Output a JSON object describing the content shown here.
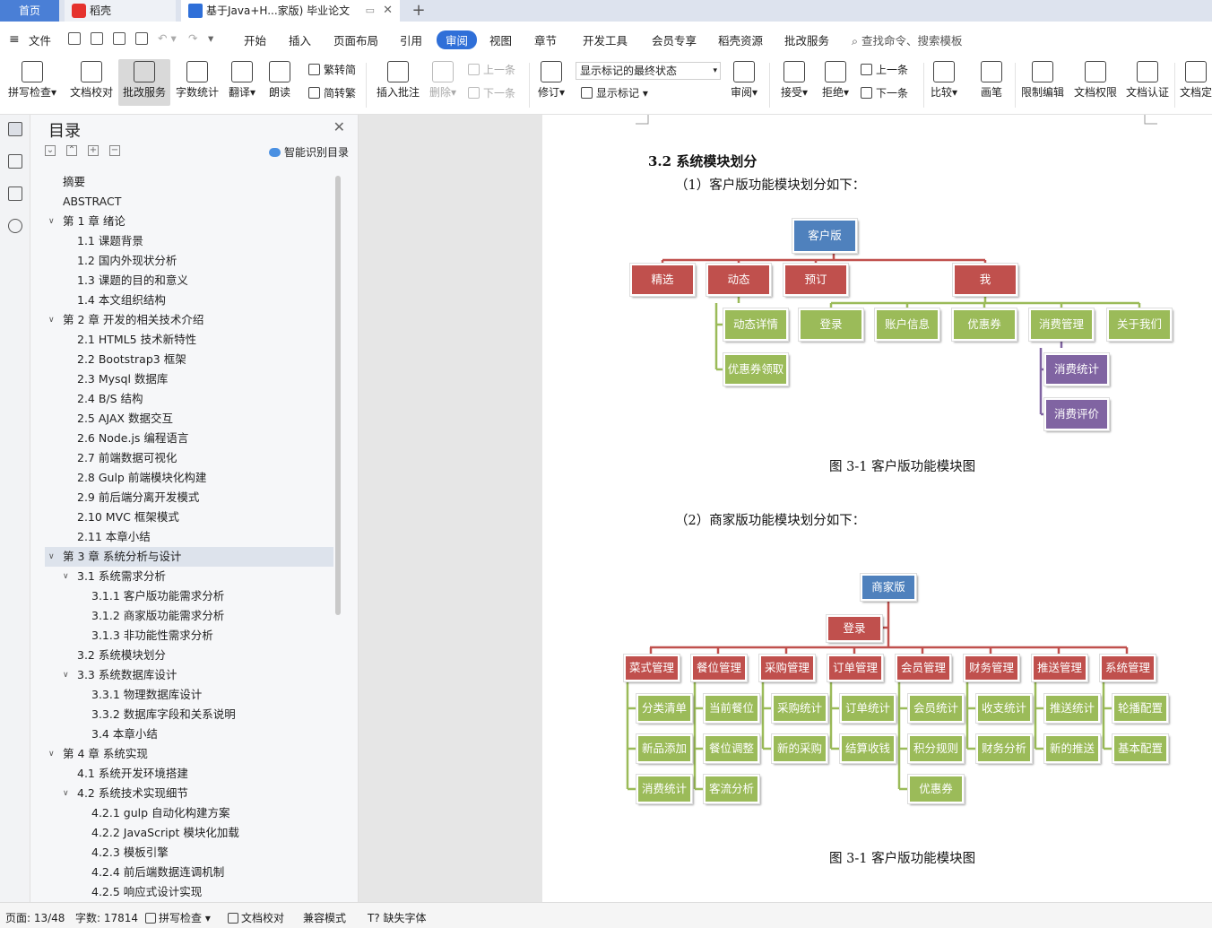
{
  "tabs": {
    "home": "首页",
    "daoke": "稻壳",
    "doc": "基于Java+H...家版)  毕业论文"
  },
  "menu": [
    "文件",
    "开始",
    "插入",
    "页面布局",
    "引用",
    "审阅",
    "视图",
    "章节",
    "开发工具",
    "会员专享",
    "稻壳资源",
    "批改服务"
  ],
  "search_placeholder": "查找命令、搜索模板",
  "ribbon": {
    "big": [
      "拼写检查",
      "文档校对",
      "批改服务",
      "字数统计",
      "翻译",
      "朗读",
      "插入批注",
      "删除",
      "修订",
      "审阅",
      "接受",
      "拒绝",
      "比较",
      "画笔",
      "限制编辑",
      "文档权限",
      "文档认证",
      "文档定"
    ],
    "small": {
      "trad": "繁转简",
      "simp": "简转繁",
      "prev1": "上一条",
      "next1": "下一条",
      "show_markup": "显示标记",
      "prev2": "上一条",
      "next2": "下一条"
    },
    "markup_state": "显示标记的最终状态"
  },
  "toc": {
    "title": "目录",
    "smart": "智能识别目录",
    "items": [
      {
        "text": "摘要",
        "level": 0,
        "caret": ""
      },
      {
        "text": "ABSTRACT",
        "level": 0,
        "caret": ""
      },
      {
        "text": "第 1 章  绪论",
        "level": 0,
        "caret": "v"
      },
      {
        "text": "1.1  课题背景",
        "level": 1,
        "caret": ""
      },
      {
        "text": "1.2  国内外现状分析",
        "level": 1,
        "caret": ""
      },
      {
        "text": "1.3  课题的目的和意义",
        "level": 1,
        "caret": ""
      },
      {
        "text": "1.4  本文组织结构",
        "level": 1,
        "caret": ""
      },
      {
        "text": "第 2 章  开发的相关技术介绍",
        "level": 0,
        "caret": "v"
      },
      {
        "text": "2.1 HTML5 技术新特性",
        "level": 1,
        "caret": ""
      },
      {
        "text": "2.2 Bootstrap3 框架",
        "level": 1,
        "caret": ""
      },
      {
        "text": "2.3 Mysql 数据库",
        "level": 1,
        "caret": ""
      },
      {
        "text": "2.4 B/S 结构",
        "level": 1,
        "caret": ""
      },
      {
        "text": "2.5 AJAX 数据交互",
        "level": 1,
        "caret": ""
      },
      {
        "text": "2.6 Node.js 编程语言",
        "level": 1,
        "caret": ""
      },
      {
        "text": "2.7 前端数据可视化",
        "level": 1,
        "caret": ""
      },
      {
        "text": "2.8 Gulp 前端模块化构建",
        "level": 1,
        "caret": ""
      },
      {
        "text": "2.9 前后端分离开发模式",
        "level": 1,
        "caret": ""
      },
      {
        "text": "2.10 MVC 框架模式",
        "level": 1,
        "caret": ""
      },
      {
        "text": "2.11  本章小结",
        "level": 1,
        "caret": ""
      },
      {
        "text": "第 3 章  系统分析与设计",
        "level": 0,
        "caret": "v",
        "selected": true
      },
      {
        "text": "3.1  系统需求分析",
        "level": 1,
        "caret": "v"
      },
      {
        "text": "3.1.1  客户版功能需求分析",
        "level": 2,
        "caret": ""
      },
      {
        "text": "3.1.2  商家版功能需求分析",
        "level": 2,
        "caret": ""
      },
      {
        "text": "3.1.3  非功能性需求分析",
        "level": 2,
        "caret": ""
      },
      {
        "text": "3.2  系统模块划分",
        "level": 1,
        "caret": ""
      },
      {
        "text": "3.3  系统数据库设计",
        "level": 1,
        "caret": "v"
      },
      {
        "text": "3.3.1 物理数据库设计",
        "level": 2,
        "caret": ""
      },
      {
        "text": "3.3.2  数据库字段和关系说明",
        "level": 2,
        "caret": ""
      },
      {
        "text": "3.4  本章小结",
        "level": 2,
        "caret": ""
      },
      {
        "text": "第 4 章  系统实现",
        "level": 0,
        "caret": "v"
      },
      {
        "text": "4.1  系统开发环境搭建",
        "level": 1,
        "caret": ""
      },
      {
        "text": "4.2  系统技术实现细节",
        "level": 1,
        "caret": "v"
      },
      {
        "text": "4.2.1 gulp 自动化构建方案",
        "level": 2,
        "caret": ""
      },
      {
        "text": "4.2.2 JavaScript 模块化加载",
        "level": 2,
        "caret": ""
      },
      {
        "text": "4.2.3  模板引擎",
        "level": 2,
        "caret": ""
      },
      {
        "text": "4.2.4  前后端数据连调机制",
        "level": 2,
        "caret": ""
      },
      {
        "text": "4.2.5  响应式设计实现",
        "level": 2,
        "caret": ""
      }
    ]
  },
  "doc": {
    "section_title": "3.2  系统模块划分",
    "sub1": "（1）客户版功能模块划分如下：",
    "caption1": "图  3-1  客户版功能模块图",
    "sub2": "（2）商家版功能模块划分如下：",
    "caption2": "图  3-1  客户版功能模块图",
    "diagram1": {
      "root": "客户版",
      "level1": [
        "精选",
        "动态",
        "预订",
        "我"
      ],
      "dynamic_children": [
        "动态详情",
        "优惠券领取"
      ],
      "me_children": [
        "登录",
        "账户信息",
        "优惠券",
        "消费管理",
        "关于我们"
      ],
      "consume_children": [
        "消费统计",
        "消费评价"
      ]
    },
    "diagram2": {
      "root": "商家版",
      "login": "登录",
      "groups": [
        {
          "name": "菜式管理",
          "children": [
            "分类清单",
            "新品添加",
            "消费统计"
          ]
        },
        {
          "name": "餐位管理",
          "children": [
            "当前餐位",
            "餐位调整",
            "客流分析"
          ]
        },
        {
          "name": "采购管理",
          "children": [
            "采购统计",
            "新的采购"
          ]
        },
        {
          "name": "订单管理",
          "children": [
            "订单统计",
            "结算收钱"
          ]
        },
        {
          "name": "会员管理",
          "children": [
            "会员统计",
            "积分规则",
            "优惠券"
          ]
        },
        {
          "name": "财务管理",
          "children": [
            "收支统计",
            "财务分析"
          ]
        },
        {
          "name": "推送管理",
          "children": [
            "推送统计",
            "新的推送"
          ]
        },
        {
          "name": "系统管理",
          "children": [
            "轮播配置",
            "基本配置"
          ]
        }
      ]
    }
  },
  "status": {
    "page": "页面: 13/48",
    "words": "字数: 17814",
    "spell": "拼写检查",
    "proof": "文档校对",
    "compat": "兼容模式",
    "font": "缺失字体"
  },
  "colors": {
    "accent": "#2f6fd8",
    "root_box": "#4f81bd",
    "level1_box": "#c0504d",
    "level2_box": "#9bbb59",
    "level3_box": "#8064a2"
  }
}
